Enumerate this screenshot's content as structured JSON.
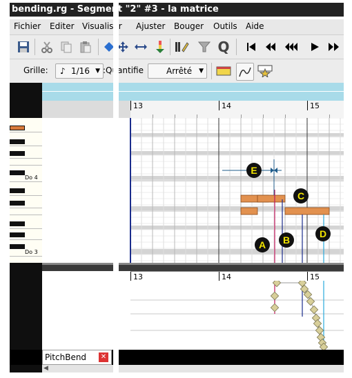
{
  "window": {
    "title": "bending.rg - Segment \"2\" #3 - la matrice"
  },
  "menu": [
    "Fichier",
    "Editer",
    "Visualiser",
    "Ajuster",
    "Bouger",
    "Outils",
    "Aide"
  ],
  "options": {
    "grid_label": "Grille:",
    "grid_value": "1/16",
    "quantize_label": "Quantifie:",
    "quantize_value": "Arrêté"
  },
  "ruler_top": {
    "m13": "13",
    "m14": "14",
    "m15": "15"
  },
  "ruler_bottom": {
    "m13": "13",
    "m14": "14",
    "m15": "15"
  },
  "piano": {
    "do4": "Do 4",
    "do3": "Do 3"
  },
  "annotations": {
    "a": "A",
    "b": "B",
    "c": "C",
    "d": "D",
    "e": "E"
  },
  "pitchbend_tab": {
    "label": "PitchBend"
  },
  "colors": {
    "note": "#e2914f",
    "marker_blue": "#1a2c8c",
    "pitch_line": "#c2185b",
    "cyan_line": "#29aadb",
    "diamond": "#d8cf9a"
  },
  "icons": [
    "save-icon",
    "cut-icon",
    "copy-icon",
    "paste-icon",
    "draw-tool-icon",
    "move-tool-icon",
    "resize-tool-icon",
    "velocity-icon",
    "note-tool-icon",
    "filter-icon",
    "quantize-icon",
    "rewind-start-icon",
    "rewind-icon",
    "fast-rewind-icon",
    "play-icon",
    "fast-forward-icon"
  ]
}
